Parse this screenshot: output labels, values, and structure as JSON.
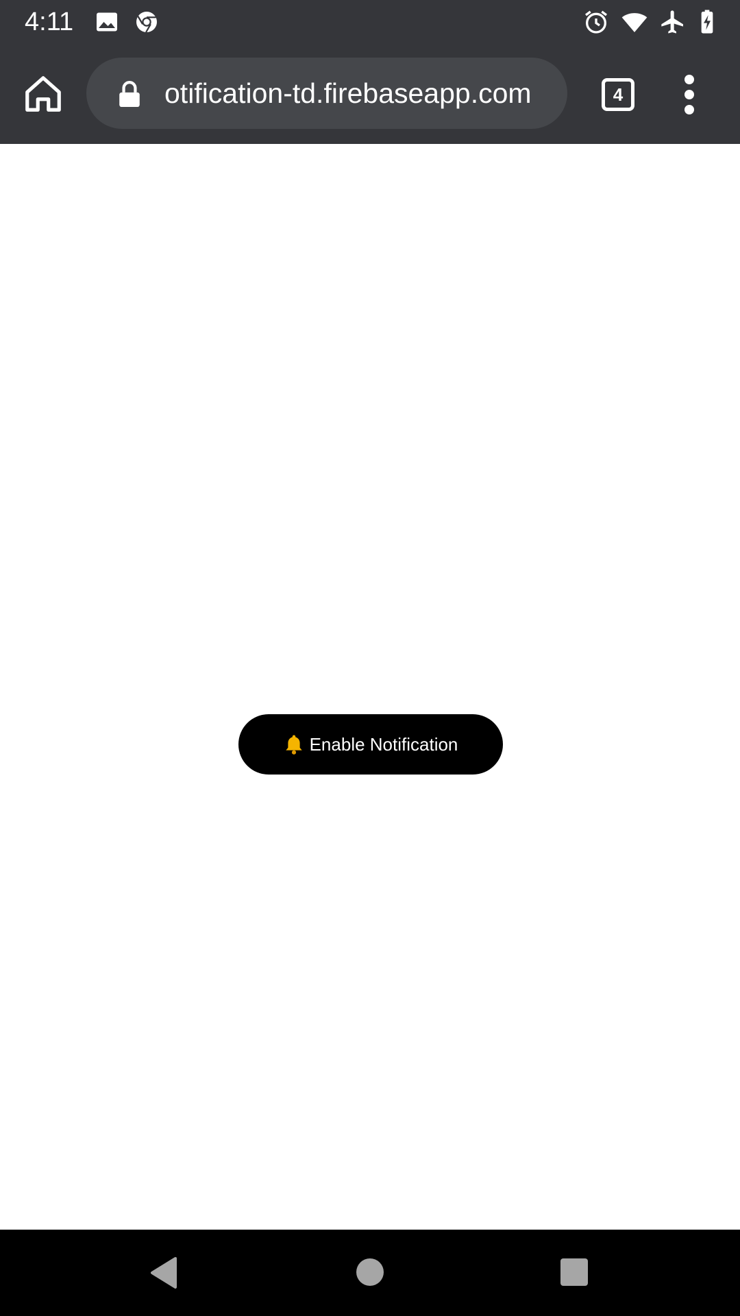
{
  "status_bar": {
    "time": "4:11",
    "left_icons": [
      "image-icon",
      "chrome-icon"
    ],
    "right_icons": [
      "alarm-icon",
      "wifi-icon",
      "airplane-icon",
      "battery-charging-icon"
    ]
  },
  "browser": {
    "url": "otification-td.firebaseapp.com",
    "tab_count": "4",
    "icons": [
      "home-icon",
      "lock-icon",
      "tab-switcher-icon",
      "more-vert-icon"
    ]
  },
  "page": {
    "enable_button_label": "Enable Notification",
    "enable_button_icon": "bell-icon"
  },
  "nav_bar": {
    "icons": [
      "back-icon",
      "home-circle-icon",
      "recents-icon"
    ]
  },
  "colors": {
    "toolbar_bg": "#35363a",
    "omnibox_bg": "#45474b",
    "button_bg": "#000000",
    "bell": "#f5b400",
    "nav_bg": "#000000"
  }
}
